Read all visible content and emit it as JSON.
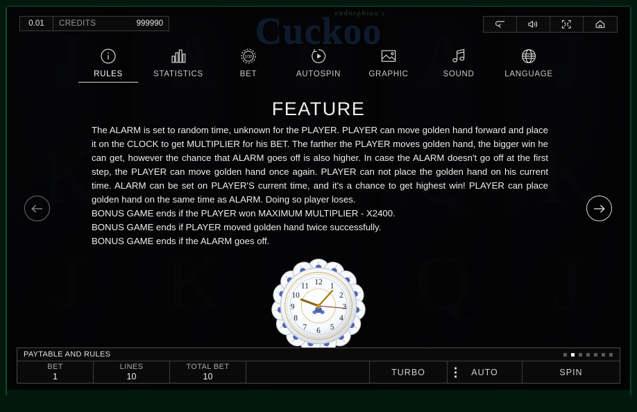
{
  "logo": {
    "brand": "endorphina's",
    "title": "Cuckoo"
  },
  "credits": {
    "denomination": "0.01",
    "label": "CREDITS",
    "value": "999990"
  },
  "top_tools": [
    {
      "name": "back-icon",
      "title": "Back"
    },
    {
      "name": "sound-icon",
      "title": "Sound"
    },
    {
      "name": "fullscreen-icon",
      "title": "Fullscreen"
    },
    {
      "name": "home-icon",
      "title": "Home"
    }
  ],
  "tabs": [
    {
      "label": "RULES",
      "icon": "info-icon",
      "active": true
    },
    {
      "label": "STATISTICS",
      "icon": "bar-chart-icon",
      "active": false
    },
    {
      "label": "BET",
      "icon": "chip-icon",
      "active": false
    },
    {
      "label": "AUTOSPIN",
      "icon": "play-circle-icon",
      "active": false
    },
    {
      "label": "GRAPHIC",
      "icon": "image-icon",
      "active": false
    },
    {
      "label": "SOUND",
      "icon": "music-note-icon",
      "active": false
    },
    {
      "label": "LANGUAGE",
      "icon": "globe-icon",
      "active": false
    }
  ],
  "chip_icon_value": "100",
  "feature": {
    "title": "FEATURE",
    "paragraph": "The ALARM is set to random time, unknown for the PLAYER. PLAYER can move golden hand forward and place it on the CLOCK to get MULTIPLIER for his BET. The farther the PLAYER moves golden hand, the bigger win he can get, however the chance that ALARM goes off is also higher. In case the ALARM doesn't go off at the first step, the PLAYER can move golden hand once again. PLAYER can not place the golden hand on his current time. ALARM can be set on PLAYER'S current time, and it's a chance to get highest win! PLAYER can place golden hand on the same time as ALARM. Doing so player loses.",
    "bonus_lines": [
      "BONUS GAME ends if the PLAYER won MAXIMUM MULTIPLIER - X2400.",
      "BONUS GAME ends if PLAYER moved golden hand twice successfully.",
      "BONUS GAME ends if the ALARM goes off."
    ]
  },
  "navigation": {
    "prev": "previous-page",
    "next": "next-page"
  },
  "clock": {
    "hour_numerals": [
      "12",
      "1",
      "2",
      "3",
      "4",
      "5",
      "6",
      "7",
      "8",
      "9",
      "10",
      "11"
    ],
    "hour_hand": "1",
    "minute_hand": "10",
    "second_hand": "3"
  },
  "bottom_bar": {
    "paytable_label": "PAYTABLE AND RULES",
    "pages": 7,
    "active_page": 2,
    "meters": [
      {
        "label": "BET",
        "value": "1"
      },
      {
        "label": "LINES",
        "value": "10"
      },
      {
        "label": "TOTAL BET",
        "value": "10"
      }
    ],
    "actions": {
      "turbo": "TURBO",
      "auto": "AUTO",
      "spin": "SPIN"
    }
  },
  "reels": [
    {
      "symbols": [
        "J",
        "K",
        "J"
      ]
    },
    {
      "symbols": [
        "A",
        "egg",
        "K"
      ]
    },
    {
      "symbols": [
        "K",
        "egg",
        "A"
      ]
    },
    {
      "symbols": [
        "A",
        "Q",
        "Q"
      ]
    },
    {
      "symbols": [
        "J",
        "K",
        "J"
      ]
    }
  ],
  "colors": {
    "frame_green": "#0d5c3a",
    "screen_bg": "#070707",
    "accent_text": "#ffffff",
    "muted_text": "#a8a8a8"
  }
}
